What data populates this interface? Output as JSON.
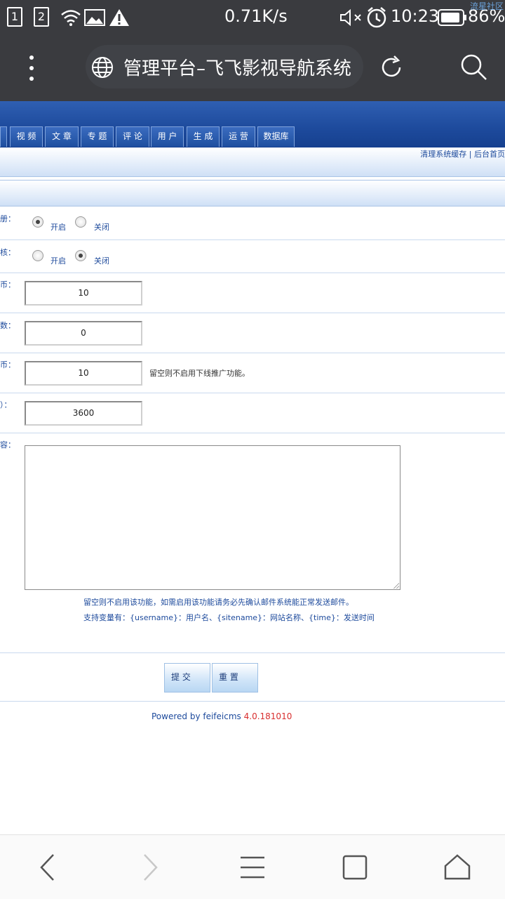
{
  "status_bar": {
    "sim1": "1",
    "sim2": "2",
    "speed": "0.71K/s",
    "time": "10:23",
    "battery": "86%",
    "watermark": "流星社区",
    "icons": [
      "sim1-icon",
      "sim2-icon",
      "wifi-icon",
      "image-icon",
      "warning-icon",
      "mute-icon",
      "alarm-icon",
      "battery-icon"
    ]
  },
  "browser": {
    "title": "管理平台–飞飞影视导航系统",
    "icons": [
      "menu-dots-icon",
      "globe-icon",
      "refresh-icon",
      "search-icon"
    ]
  },
  "admin_nav": {
    "tabs": [
      {
        "label": "视 频"
      },
      {
        "label": "文 章"
      },
      {
        "label": "专 题"
      },
      {
        "label": "评 论"
      },
      {
        "label": "用 户"
      },
      {
        "label": "生 成"
      },
      {
        "label": "运 营"
      },
      {
        "label": "数据库"
      }
    ],
    "top_links": "清理系统缓存 | 后台首页"
  },
  "form": {
    "rows": [
      {
        "label": "册：",
        "type": "radio",
        "options": [
          "开启",
          "关闭"
        ],
        "selected": "开启"
      },
      {
        "label": "核：",
        "type": "radio",
        "options": [
          "开启",
          "关闭"
        ],
        "selected": "关闭"
      },
      {
        "label": "币：",
        "type": "text",
        "value": "10"
      },
      {
        "label": "数：",
        "type": "text",
        "value": "0"
      },
      {
        "label": "币：",
        "type": "text",
        "value": "10",
        "hint": "留空则不启用下线推广功能。"
      },
      {
        "label": "）：",
        "type": "text",
        "value": "3600"
      },
      {
        "label": "容：",
        "type": "textarea",
        "value": ""
      }
    ],
    "note1": "留空则不启用该功能，如需启用该功能请务必先确认邮件系统能正常发送邮件。",
    "note2": "支持变量有：{username}：用户名、{sitename}：网站名称、{time}：发送时间",
    "submit_label": "提 交",
    "reset_label": "重 置"
  },
  "footer": {
    "powered": "Powered by feifeicms",
    "version": "4.0.181010"
  },
  "bottom_nav": {
    "icons": [
      "back-icon",
      "forward-icon",
      "menu-icon",
      "tabs-icon",
      "home-icon"
    ]
  },
  "colors": {
    "header_blue": "#1d4a9c",
    "link_blue": "#1d4a9c",
    "version_red": "#d82e2e",
    "chrome_dark": "#3a3b3f"
  }
}
